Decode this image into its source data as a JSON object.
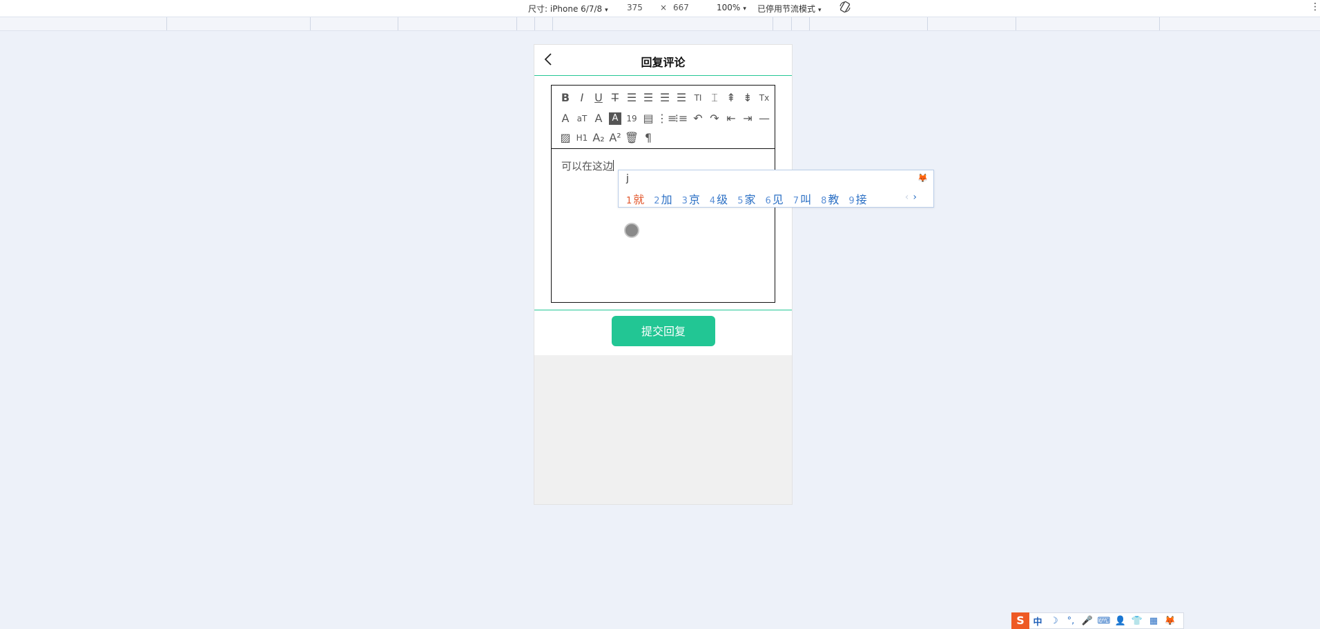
{
  "devtools": {
    "device_label": "尺寸: iPhone 6/7/8",
    "width": "375",
    "times": "×",
    "height": "667",
    "zoom": "100%",
    "throttle": "已停用节流模式",
    "caret": "▾",
    "more_icon": "⋮"
  },
  "page": {
    "title": "回复评论",
    "editor_text": "可以在这边",
    "submit_label": "提交回复"
  },
  "toolbar": {
    "row1": [
      {
        "icon": "bold-icon",
        "glyph": "B"
      },
      {
        "icon": "italic-icon",
        "glyph": "I"
      },
      {
        "icon": "underline-icon",
        "glyph": "U"
      },
      {
        "icon": "strikethrough-icon",
        "glyph": "T̶"
      },
      {
        "icon": "align-left-icon",
        "glyph": "☰"
      },
      {
        "icon": "align-center-icon",
        "glyph": "☰"
      },
      {
        "icon": "align-right-icon",
        "glyph": "☰"
      },
      {
        "icon": "align-justify-icon",
        "glyph": "☰"
      },
      {
        "icon": "font-size-icon",
        "glyph": "TI"
      },
      {
        "icon": "line-height-icon",
        "glyph": "⌶"
      },
      {
        "icon": "space-before-icon",
        "glyph": "⇞"
      },
      {
        "icon": "space-after-icon",
        "glyph": "⇟"
      },
      {
        "icon": "clear-format-icon",
        "glyph": "Tx"
      }
    ],
    "row2": [
      {
        "icon": "font-family-icon",
        "glyph": "A"
      },
      {
        "icon": "text-size-icon",
        "glyph": "aT"
      },
      {
        "icon": "font-color-icon",
        "glyph": "A"
      },
      {
        "icon": "background-color-icon",
        "glyph": "A"
      },
      {
        "icon": "date-icon",
        "glyph": "19"
      },
      {
        "icon": "time-icon",
        "glyph": "▤"
      },
      {
        "icon": "ordered-list-icon",
        "glyph": "⋮≡"
      },
      {
        "icon": "unordered-list-icon",
        "glyph": "⁝≡"
      },
      {
        "icon": "undo-icon",
        "glyph": "↶"
      },
      {
        "icon": "redo-icon",
        "glyph": "↷"
      },
      {
        "icon": "outdent-icon",
        "glyph": "⇤"
      },
      {
        "icon": "indent-icon",
        "glyph": "⇥"
      },
      {
        "icon": "horizontal-rule-icon",
        "glyph": "—"
      }
    ],
    "row3": [
      {
        "icon": "image-icon",
        "glyph": "▨"
      },
      {
        "icon": "heading-icon",
        "glyph": "H1"
      },
      {
        "icon": "subscript-icon",
        "glyph": "A₂"
      },
      {
        "icon": "superscript-icon",
        "glyph": "A²"
      },
      {
        "icon": "delete-icon",
        "glyph": "🗑"
      },
      {
        "icon": "paragraph-icon",
        "glyph": "¶"
      }
    ]
  },
  "ime": {
    "input": "j",
    "candidates": [
      {
        "num": "1",
        "text": "就"
      },
      {
        "num": "2",
        "text": "加"
      },
      {
        "num": "3",
        "text": "京"
      },
      {
        "num": "4",
        "text": "级"
      },
      {
        "num": "5",
        "text": "家"
      },
      {
        "num": "6",
        "text": "见"
      },
      {
        "num": "7",
        "text": "叫"
      },
      {
        "num": "8",
        "text": "教"
      },
      {
        "num": "9",
        "text": "接"
      }
    ],
    "prev": "‹",
    "next": "›",
    "status": {
      "logo": "S",
      "mode": "中",
      "items": [
        "☽",
        "°,",
        "🎤",
        "⌨",
        "👤",
        "👕",
        "▦",
        "🦊"
      ]
    }
  },
  "colors": {
    "accent": "#22c694",
    "background": "#edf1f9",
    "ime_highlight": "#e2562b",
    "ime_text": "#2a6fc4"
  }
}
